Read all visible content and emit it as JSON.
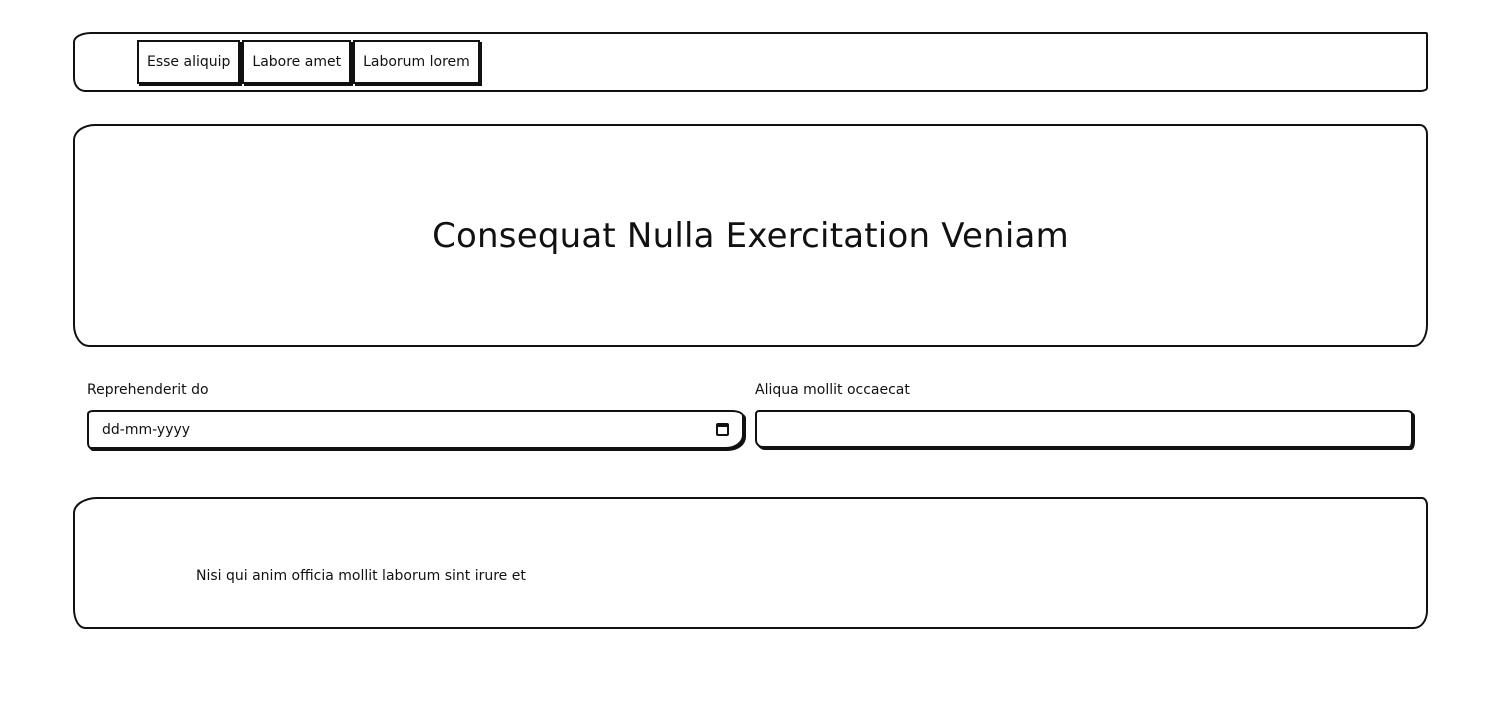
{
  "nav": {
    "buttons": [
      {
        "label": "Esse aliquip"
      },
      {
        "label": "Labore amet"
      },
      {
        "label": "Laborum lorem"
      }
    ]
  },
  "hero": {
    "title": "Consequat Nulla Exercitation Veniam"
  },
  "form": {
    "date_field": {
      "label": "Reprehenderit do",
      "placeholder": "dd-mm-yyyy"
    },
    "text_field": {
      "label": "Aliqua mollit occaecat",
      "value": ""
    }
  },
  "footer": {
    "text": "Nisi qui anim officia mollit laborum sint irure et"
  }
}
